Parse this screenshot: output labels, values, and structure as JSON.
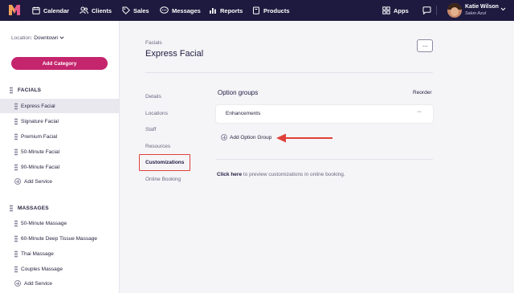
{
  "nav": {
    "items": [
      {
        "label": "Calendar",
        "icon": "calendar-icon"
      },
      {
        "label": "Clients",
        "icon": "users-icon"
      },
      {
        "label": "Sales",
        "icon": "tag-icon"
      },
      {
        "label": "Messages",
        "icon": "chat-icon"
      },
      {
        "label": "Reports",
        "icon": "bar-chart-icon"
      },
      {
        "label": "Products",
        "icon": "box-icon"
      }
    ],
    "apps_label": "Apps",
    "user_name": "Katie Wilson",
    "user_business": "Salon Azul"
  },
  "sidebar": {
    "location_label": "Location:",
    "location_value": "Downtown",
    "add_category_label": "Add Category",
    "sections": [
      {
        "title": "FACIALS",
        "services": [
          "Express Facial",
          "Signature Facial",
          "Premium Facial",
          "50-Minute Facial",
          "90-Minute Facial"
        ],
        "add_label": "Add Service"
      },
      {
        "title": "MASSAGES",
        "services": [
          "50-Minute Massage",
          "60-Minute Deep Tissue Massage",
          "Thai Massage",
          "Couples Massage"
        ],
        "add_label": "Add Service"
      }
    ],
    "active_service": "Express Facial"
  },
  "main": {
    "breadcrumb": "Facials",
    "title": "Express Facial",
    "more_label": "···",
    "subnav": [
      "Details",
      "Locations",
      "Staff",
      "Resources",
      "Customizations",
      "Online Booking"
    ],
    "active_subnav": "Customizations",
    "option_groups_title": "Option groups",
    "reorder_label": "Reorder",
    "option_groups": [
      {
        "label": "Enhancements",
        "more": "···"
      }
    ],
    "add_option_group_label": "Add Option Group",
    "preview_link": "Click here",
    "preview_rest": " to preview customizations in online booking."
  },
  "colors": {
    "nav_bg": "#1e1a3f",
    "accent": "#c4256d",
    "annotation_red": "#e0403a"
  }
}
